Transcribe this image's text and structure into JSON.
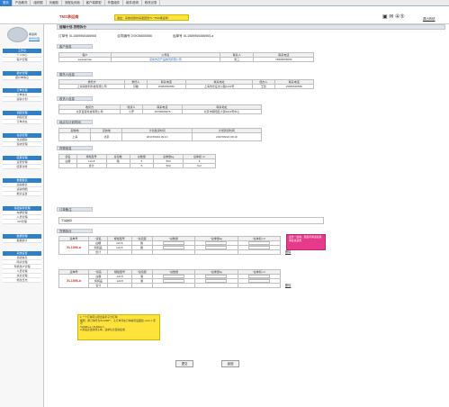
{
  "topnav": {
    "tabs": [
      "首页",
      "产品概况",
      "组织图",
      "页面图",
      "流程及页面",
      "客户端原型",
      "外围组件",
      "组件说明",
      "修改记录"
    ],
    "active_index": 0
  },
  "header": {
    "app_title": "TMS承运商",
    "notice": "退出：系统切换时请退回到\"5 / TMS承运商\"",
    "icons_text": "▣ ✉ ④⑤",
    "logout": "退出系统"
  },
  "sidebar": {
    "user_name": "承运商",
    "user_link": "账号管理",
    "groups": [
      {
        "head": "工作台",
        "items": [
          "个人中心",
          "客户管理"
        ]
      },
      {
        "head": "报价管理",
        "items": [
          "报价单信息"
        ]
      },
      {
        "head": "订单管理",
        "items": [
          "订单信息",
          "运输计划"
        ]
      },
      {
        "head": "调度管理",
        "items": [
          "调度配置",
          "订单状态"
        ]
      },
      {
        "head": "在途管理",
        "items": [
          "在途跟踪",
          "签收管理"
        ]
      },
      {
        "head": "结算管理",
        "items": [
          "运费管理",
          "结算对账"
        ]
      },
      {
        "head": "数据报表",
        "items": [
          "运输报表",
          "运输明细",
          "报表设置"
        ]
      },
      {
        "head": "基础资料管理",
        "items": [
          "车辆管理",
          "人员管理",
          "KPI管理"
        ]
      },
      {
        "head": "数据管理",
        "items": [
          "数据统计"
        ]
      },
      {
        "head": "系统设置",
        "items": [
          "基础信息",
          "网点管理",
          "司机账户管理",
          "人员管理",
          "消息管理",
          "修改日志"
        ]
      }
    ]
  },
  "main": {
    "page_title": "运输计划-货物拆分",
    "order_no_label": "订单号 XL1589965486965",
    "contract_label": "合同编号 DSK56655566",
    "transport_label": "运单号 XL1589965486965-a",
    "customer": {
      "title": "客户信息",
      "headers": [
        "客户",
        "公司名",
        "联系人",
        "联系电话"
      ],
      "row": [
        "sanleaohan",
        "深圳市农产品物流有限公司",
        "张三",
        "15966566659"
      ]
    },
    "consignor": {
      "title": "委托人信息",
      "headers": [
        "委托方",
        "委托人",
        "联系电话",
        "联系地址",
        "经办人",
        "联系电话"
      ],
      "row": [
        "上海海象利科技有限公司",
        "闫敏",
        "15966666656",
        "上海市长征支川路1101号",
        "王凯",
        "15966636566"
      ]
    },
    "receiver": {
      "title": "收货人信息",
      "headers": [
        "收货方",
        "收货人",
        "联系电话",
        "联系地址"
      ],
      "row": [
        "北京百度科技有限公司",
        "小罗",
        "15756665875",
        "北京市朝阳区大铜1019号中心"
      ]
    },
    "route": {
      "title": "地点与计划时间",
      "headers": [
        "起始地",
        "目的地",
        "计划发货时间",
        "计划到货时间"
      ],
      "row": [
        "上海",
        "北京",
        "2017/09/24 09:10",
        "2017/09/24 09:10"
      ]
    },
    "goods": {
      "title": "货物信息",
      "headers": [
        "货名",
        "规格型号",
        "总包数",
        "总数量",
        "总重量kg",
        "总体积 m³"
      ],
      "rows": [
        [
          "白糖",
          "1x0.8",
          "箱",
          "5",
          "500",
          "6"
        ],
        [
          "",
          "合计",
          "",
          "5",
          "500",
          "6m³"
        ]
      ]
    },
    "remark": {
      "title": "订单备注",
      "value": "不得破碎"
    },
    "split": {
      "title": "货物拆分",
      "headers": [
        "运单号",
        "*货名",
        "规格型号",
        "*总包装",
        "*总数量",
        "*总重量kg",
        "*总体积 m³"
      ],
      "orders": [
        {
          "no": "XL1596-a",
          "items": [
            [
              "白糖",
              "1x0.8",
              "箱"
            ],
            [
              "焖焖品",
              "1x0.8",
              "箱"
            ]
          ],
          "total": "合计",
          "delete": "删除"
        },
        {
          "no": "XL1596-b",
          "items": [
            [
              "白糖",
              "1x0.8",
              "箱"
            ],
            [
              "焖焖品",
              "1x0.8",
              "箱"
            ]
          ],
          "total": "合计",
          "delete": "删除"
        }
      ]
    },
    "pink_note": "业务一运单，随后可承运商来承接总运费",
    "yellow_note": "1.一个订单可以拆出多条子分订单\n规则：拆订单号为XL1596**，子订单号在订单编号后面加 -a/-b/-c 序号\n XL5001-a / XL5001-b\n 2.拆后点击新增子单，连单信息自动生成",
    "buttons": {
      "submit": "提交",
      "back": "返回"
    }
  }
}
